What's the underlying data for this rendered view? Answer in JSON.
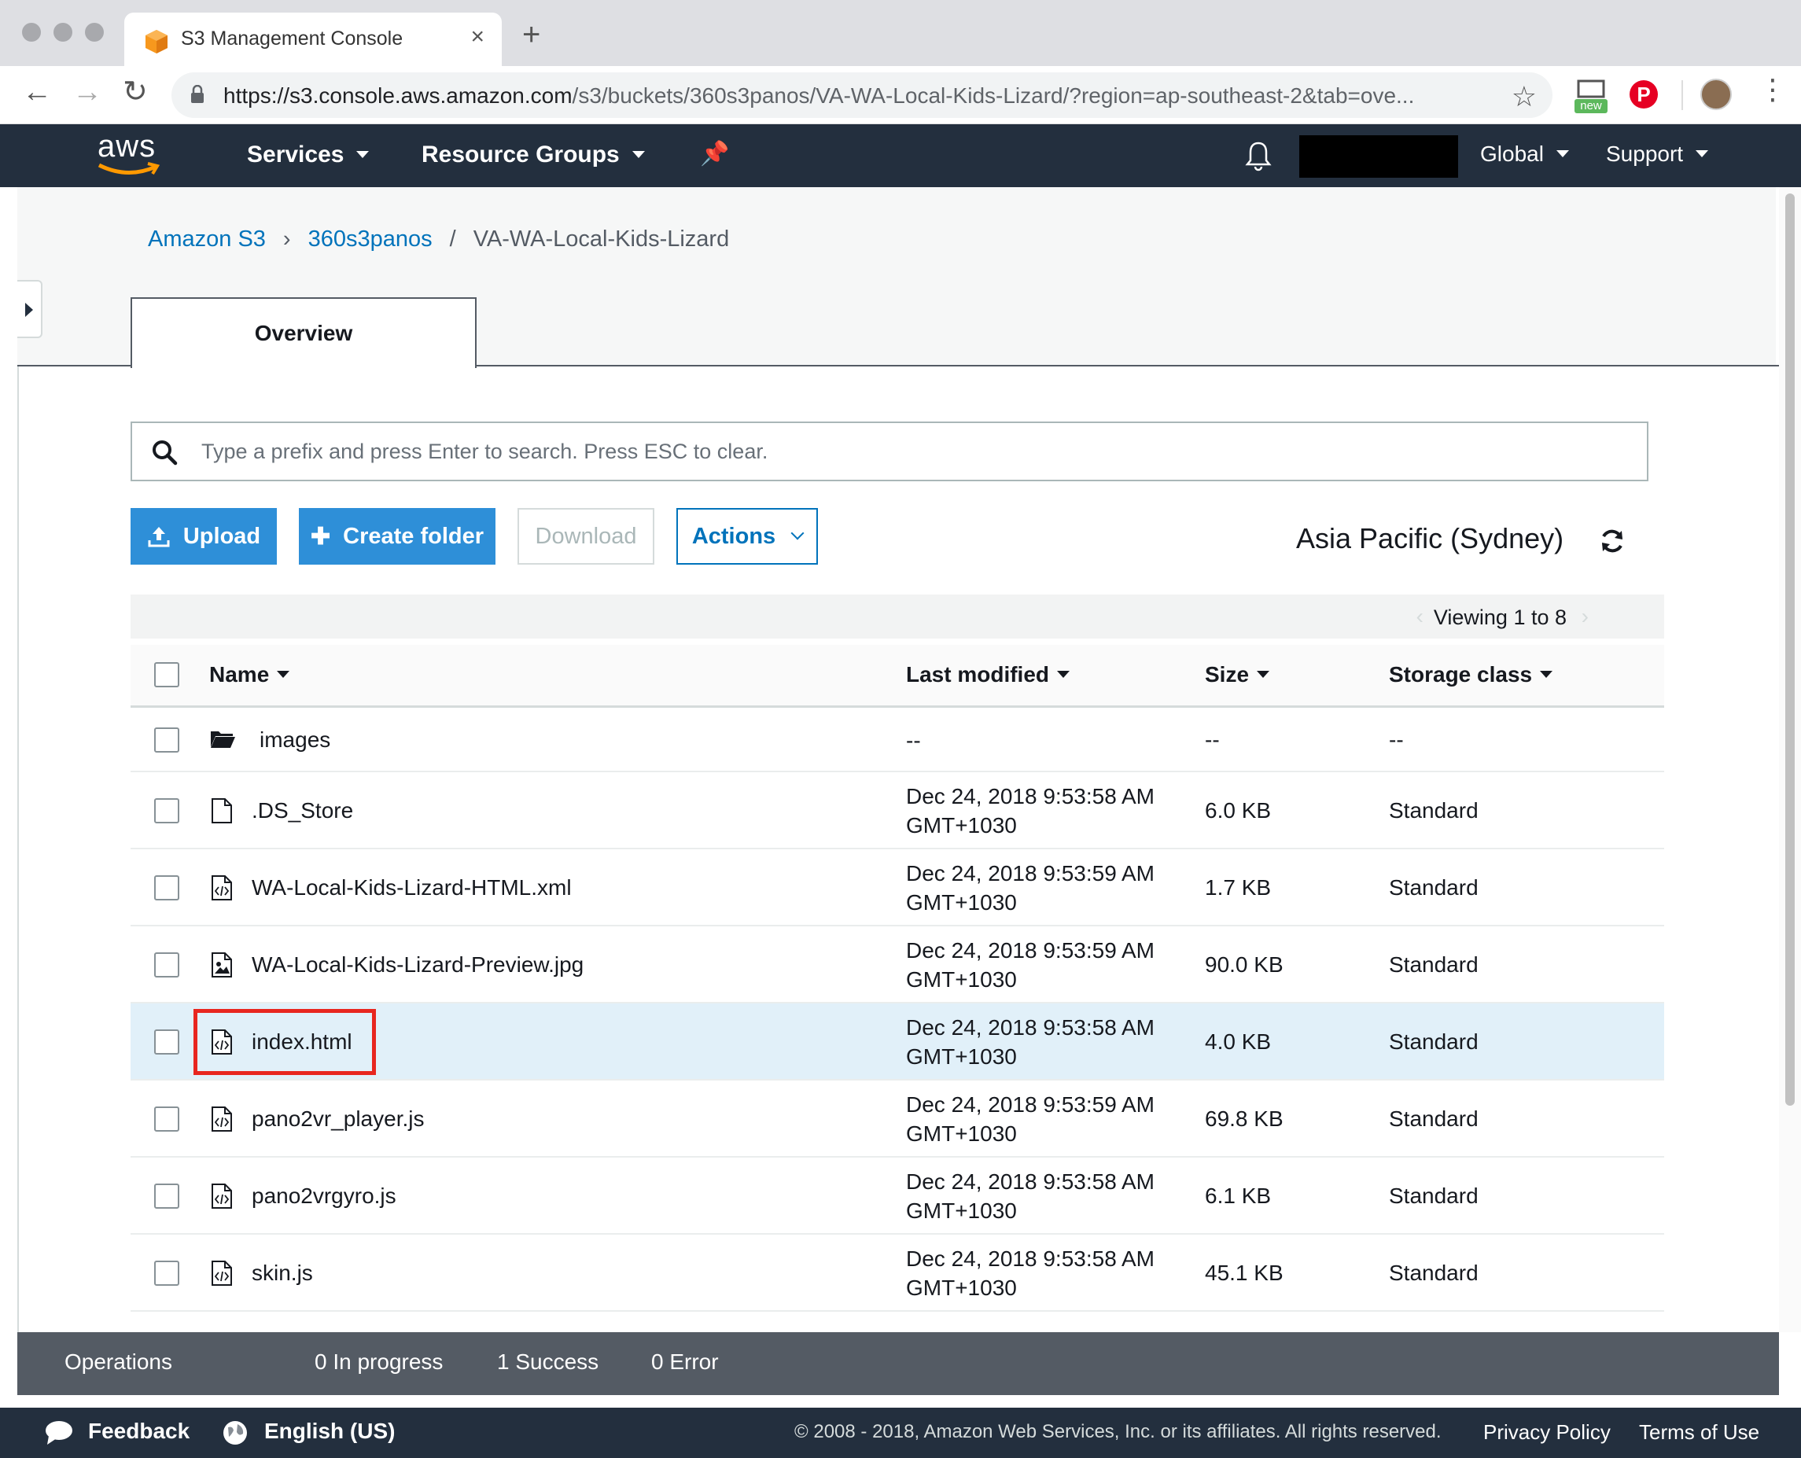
{
  "browser": {
    "tab_title": "S3 Management Console",
    "url_host": "https://s3.console.aws.amazon.com",
    "url_path": "/s3/buckets/360s3panos/VA-WA-Local-Kids-Lizard/?region=ap-southeast-2&tab=ove...",
    "extension_badge": "new"
  },
  "nav": {
    "logo": "aws",
    "services": "Services",
    "resource_groups": "Resource Groups",
    "global": "Global",
    "support": "Support"
  },
  "breadcrumb": {
    "root": "Amazon S3",
    "bucket": "360s3panos",
    "folder": "VA-WA-Local-Kids-Lizard"
  },
  "tabs": {
    "overview": "Overview"
  },
  "search": {
    "placeholder": "Type a prefix and press Enter to search. Press ESC to clear."
  },
  "toolbar": {
    "upload": "Upload",
    "create_folder": "Create folder",
    "download": "Download",
    "actions": "Actions",
    "region": "Asia Pacific (Sydney)"
  },
  "pager": {
    "text": "Viewing 1 to 8"
  },
  "table": {
    "columns": {
      "name": "Name",
      "modified": "Last modified",
      "size": "Size",
      "storage": "Storage class"
    },
    "rows": [
      {
        "type": "folder",
        "name": "images",
        "date": "--",
        "tz": "",
        "size": "--",
        "storage": "--"
      },
      {
        "type": "file",
        "name": ".DS_Store",
        "date": "Dec 24, 2018 9:53:58 AM",
        "tz": "GMT+1030",
        "size": "6.0 KB",
        "storage": "Standard"
      },
      {
        "type": "code",
        "name": "WA-Local-Kids-Lizard-HTML.xml",
        "date": "Dec 24, 2018 9:53:59 AM",
        "tz": "GMT+1030",
        "size": "1.7 KB",
        "storage": "Standard"
      },
      {
        "type": "image",
        "name": "WA-Local-Kids-Lizard-Preview.jpg",
        "date": "Dec 24, 2018 9:53:59 AM",
        "tz": "GMT+1030",
        "size": "90.0 KB",
        "storage": "Standard"
      },
      {
        "type": "code",
        "name": "index.html",
        "date": "Dec 24, 2018 9:53:58 AM",
        "tz": "GMT+1030",
        "size": "4.0 KB",
        "storage": "Standard"
      },
      {
        "type": "code",
        "name": "pano2vr_player.js",
        "date": "Dec 24, 2018 9:53:59 AM",
        "tz": "GMT+1030",
        "size": "69.8 KB",
        "storage": "Standard"
      },
      {
        "type": "code",
        "name": "pano2vrgyro.js",
        "date": "Dec 24, 2018 9:53:58 AM",
        "tz": "GMT+1030",
        "size": "6.1 KB",
        "storage": "Standard"
      },
      {
        "type": "code",
        "name": "skin.js",
        "date": "Dec 24, 2018 9:53:58 AM",
        "tz": "GMT+1030",
        "size": "45.1 KB",
        "storage": "Standard"
      }
    ],
    "selected_row": "index.html"
  },
  "operations": {
    "label": "Operations",
    "in_progress": "0 In progress",
    "success": "1 Success",
    "error": "0 Error"
  },
  "footer": {
    "feedback": "Feedback",
    "language": "English (US)",
    "copyright": "© 2008 - 2018, Amazon Web Services, Inc. or its affiliates. All rights reserved.",
    "privacy": "Privacy Policy",
    "terms": "Terms of Use"
  },
  "colors": {
    "nav_bg": "#232f3e",
    "primary_button": "#2e8fd8",
    "link": "#0073bb",
    "selected_row": "#e1f0f9",
    "highlight": "#e8261f"
  }
}
